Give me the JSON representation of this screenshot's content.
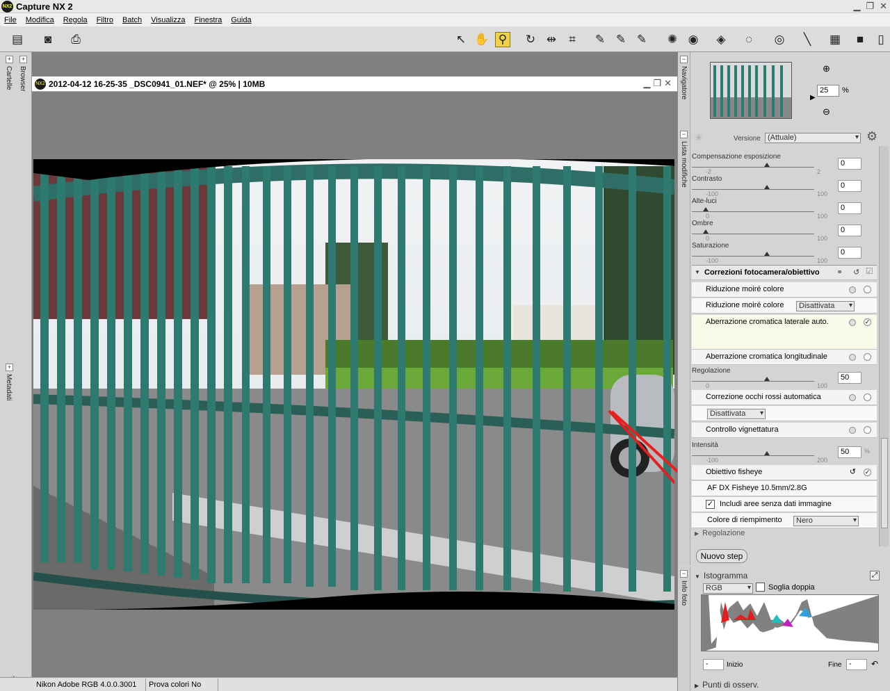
{
  "app": {
    "title": "Capture NX 2",
    "logo": "NX2"
  },
  "menu": [
    "File",
    "Modifica",
    "Regola",
    "Filtro",
    "Batch",
    "Visualizza",
    "Finestra",
    "Guida"
  ],
  "left_tabs": {
    "cartelle": "Cartelle",
    "browser": "Browser",
    "metadati": "Metadati"
  },
  "document": {
    "title": "2012-04-12  16-25-35  _DSC0941_01.NEF* @ 25%  |  10MB"
  },
  "status": {
    "profile": "Nikon Adobe RGB 4.0.0.3001",
    "proof": "Prova colori No"
  },
  "navigator": {
    "label": "Navigatore",
    "zoom_value": "25",
    "zoom_unit": "%"
  },
  "edit_list": {
    "label": "Lista modifiche",
    "version_label": "Versione",
    "version_value": "(Attuale)",
    "sliders": [
      {
        "label": "Compensazione esposizione",
        "min": "-2",
        "max": "2",
        "value": "0",
        "pos": 0.5
      },
      {
        "label": "Contrasto",
        "min": "-100",
        "max": "100",
        "value": "0",
        "pos": 0.5
      },
      {
        "label": "Alte-luci",
        "min": "0",
        "max": "100",
        "value": "0",
        "pos": 0.0
      },
      {
        "label": "Ombre",
        "min": "0",
        "max": "100",
        "value": "0",
        "pos": 0.0
      },
      {
        "label": "Saturazione",
        "min": "-100",
        "max": "100",
        "value": "0",
        "pos": 0.5
      }
    ],
    "section_title": "Correzioni fotocamera/obiettivo",
    "moire_title": "Riduzione moiré colore",
    "moire_label": "Riduzione moiré colore",
    "moire_value": "Disattivata",
    "lateral_ca": "Aberrazione cromatica laterale auto.",
    "longitudinal_ca": "Aberrazione cromatica longitudinale",
    "long_ca_slider": {
      "label": "Regolazione",
      "min": "0",
      "max": "100",
      "value": "50",
      "pos": 0.5
    },
    "redeye_title": "Correzione occhi rossi automatica",
    "redeye_value": "Disattivata",
    "vignette_title": "Controllo vignettatura",
    "vignette_slider": {
      "label": "Intensità",
      "min": "-100",
      "max": "200",
      "value": "50",
      "unit": "%",
      "pos": 0.5
    },
    "fisheye_title": "Obiettivo fisheye",
    "fisheye_lens": "AF DX Fisheye 10.5mm/2.8G",
    "fisheye_include": "Includi aree senza dati immagine",
    "fill_color_label": "Colore di riempimento",
    "fill_color_value": "Nero",
    "regolazione": "Regolazione",
    "new_step": "Nuovo step"
  },
  "info": {
    "label": "Info foto",
    "histogram_title": "Istogramma",
    "channel": "RGB",
    "double_threshold": "Soglia doppia",
    "start_label": "Inizio",
    "start_value": "-",
    "end_label": "Fine",
    "end_value": "-",
    "observation": "Punti di osserv."
  }
}
